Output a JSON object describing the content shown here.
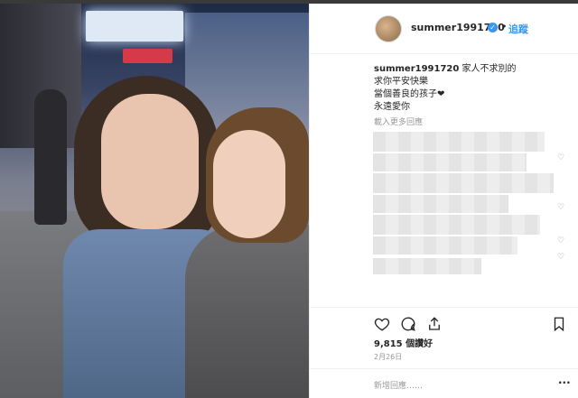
{
  "header": {
    "username": "summer1991720",
    "verified_icon": "verified-badge-icon",
    "separator": "•",
    "follow_label": "追蹤"
  },
  "caption": {
    "username": "summer1991720",
    "lines": [
      "家人不求別的",
      "求你平安快樂",
      "當個善良的孩子❤",
      "永遠愛你"
    ]
  },
  "comments": {
    "load_more_label": "載入更多回應"
  },
  "actions": {
    "like_icon": "heart-icon",
    "comment_icon": "comment-icon",
    "share_icon": "share-icon",
    "save_icon": "bookmark-icon"
  },
  "likes_text": "9,815 個讚好",
  "date_text": "2月26日",
  "add_comment": {
    "placeholder": "新增回應……",
    "more_label": "···"
  },
  "colors": {
    "accent": "#3897f0",
    "text": "#262626",
    "muted": "#999999"
  }
}
